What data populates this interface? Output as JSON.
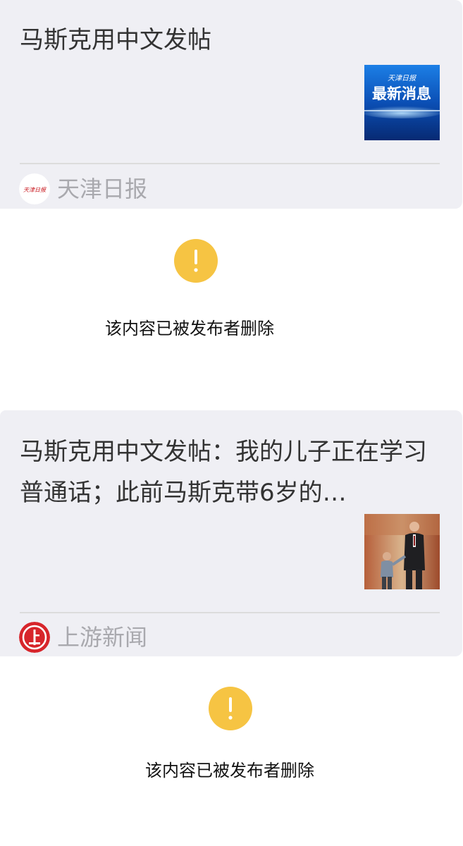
{
  "articles": [
    {
      "title": "马斯克用中文发帖",
      "thumbnail": {
        "icon": "news-broadcast-thumbnail",
        "masthead": "天津日报",
        "caption": "最新消息"
      },
      "source": {
        "name": "天津日报",
        "logo_icon": "tianjin-daily-logo",
        "logo_text": "天津日报"
      }
    },
    {
      "title": "马斯克用中文发帖：我的儿子正在学习普通话；此前马斯克带6岁的…",
      "thumbnail": {
        "icon": "photo-thumbnail"
      },
      "source": {
        "name": "上游新闻",
        "logo_icon": "shangyou-news-logo"
      }
    }
  ],
  "notices": [
    {
      "text": "该内容已被发布者删除",
      "icon": "warning-icon"
    },
    {
      "text": "该内容已被发布者删除",
      "icon": "warning-icon"
    }
  ],
  "colors": {
    "card_bg": "#efeff4",
    "warning": "#f6c443",
    "source_text": "#a9a9ae",
    "title_text": "#333333",
    "shangyou_red": "#d7252b",
    "thumb_blue": "#0b4fb5"
  }
}
